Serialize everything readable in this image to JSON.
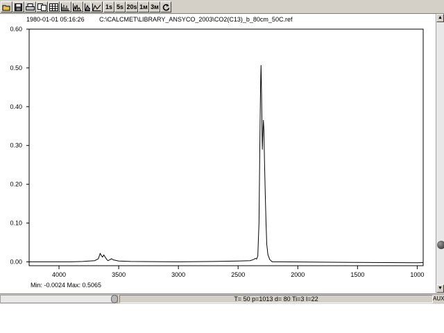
{
  "toolbar": {
    "buttons": [
      {
        "name": "open-icon",
        "label": ""
      },
      {
        "name": "save-icon",
        "label": ""
      },
      {
        "name": "print-icon",
        "label": ""
      },
      {
        "name": "copy-icon",
        "label": ""
      },
      {
        "name": "grid-icon",
        "label": ""
      },
      {
        "name": "spectrum-bars-icon",
        "label": ""
      },
      {
        "name": "spectrum-peaks-icon",
        "label": ""
      },
      {
        "name": "area-icon",
        "label": ""
      },
      {
        "name": "line-icon",
        "label": ""
      },
      {
        "name": "interval-1s",
        "label": "1s"
      },
      {
        "name": "interval-5s",
        "label": "5s"
      },
      {
        "name": "interval-20s",
        "label": "20s"
      },
      {
        "name": "interval-1m",
        "label": "1м"
      },
      {
        "name": "interval-3m",
        "label": "3м"
      },
      {
        "name": "refresh-icon",
        "label": ""
      }
    ]
  },
  "header": {
    "timestamp": "1980-01-01 05:16:26",
    "file_path": "C:\\CALCMET\\LIBRARY_ANSYCO_2003\\CO2(C13)_b_80cm_50C.ref"
  },
  "stats": {
    "text": "Min: -0.0024  Max: 0.5065"
  },
  "status_bar": {
    "text": "T= 50  p=1013  d=  80   Ti=3  I=22",
    "aux": "AUX"
  },
  "chart_data": {
    "type": "line",
    "title": "",
    "xlabel": "",
    "ylabel": "",
    "xlim": [
      4250,
      950
    ],
    "ylim": [
      -0.01,
      0.6
    ],
    "x_reversed": true,
    "grid": false,
    "x_ticks": [
      4000,
      3500,
      3000,
      2500,
      2000,
      1500,
      1000
    ],
    "y_ticks": [
      0.0,
      0.1,
      0.2,
      0.3,
      0.4,
      0.5,
      0.6
    ],
    "y_tick_labels": [
      "0.00",
      "0.10",
      "0.20",
      "0.30",
      "0.40",
      "0.50",
      "0.60"
    ],
    "min": -0.0024,
    "max": 0.5065,
    "series": [
      {
        "color": "#000000",
        "points": [
          [
            4250,
            0.0
          ],
          [
            3900,
            0.0
          ],
          [
            3800,
            0.001
          ],
          [
            3700,
            0.003
          ],
          [
            3670,
            0.008
          ],
          [
            3655,
            0.022
          ],
          [
            3645,
            0.016
          ],
          [
            3635,
            0.012
          ],
          [
            3625,
            0.018
          ],
          [
            3615,
            0.013
          ],
          [
            3600,
            0.006
          ],
          [
            3590,
            0.003
          ],
          [
            3570,
            0.006
          ],
          [
            3560,
            0.008
          ],
          [
            3545,
            0.005
          ],
          [
            3530,
            0.004
          ],
          [
            3500,
            0.002
          ],
          [
            3400,
            0.001
          ],
          [
            3000,
            0.0
          ],
          [
            2700,
            0.001
          ],
          [
            2500,
            0.002
          ],
          [
            2400,
            0.003
          ],
          [
            2370,
            0.006
          ],
          [
            2355,
            0.009
          ],
          [
            2345,
            0.007
          ],
          [
            2335,
            0.015
          ],
          [
            2325,
            0.1
          ],
          [
            2318,
            0.3
          ],
          [
            2312,
            0.45
          ],
          [
            2308,
            0.5065
          ],
          [
            2304,
            0.44
          ],
          [
            2300,
            0.35
          ],
          [
            2297,
            0.29
          ],
          [
            2293,
            0.33
          ],
          [
            2288,
            0.365
          ],
          [
            2284,
            0.34
          ],
          [
            2279,
            0.26
          ],
          [
            2273,
            0.18
          ],
          [
            2266,
            0.1
          ],
          [
            2260,
            0.045
          ],
          [
            2250,
            0.018
          ],
          [
            2235,
            0.006
          ],
          [
            2215,
            0.0
          ],
          [
            2150,
            0.0
          ],
          [
            1500,
            -0.0015
          ],
          [
            1000,
            -0.0024
          ],
          [
            950,
            -0.002
          ]
        ]
      }
    ]
  }
}
